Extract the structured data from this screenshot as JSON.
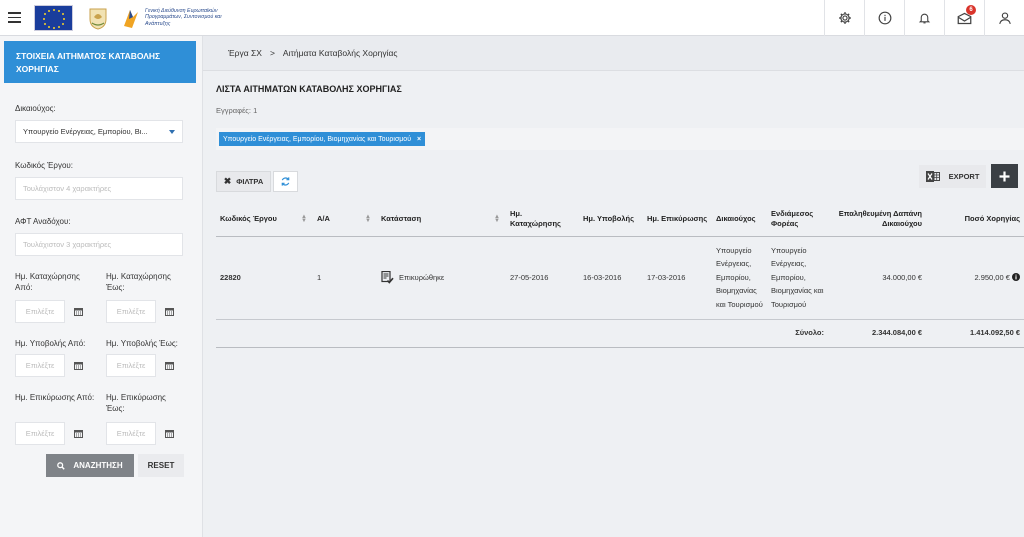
{
  "header": {
    "org_logo_text": "Γενική Διεύθυνση Ευρωπαϊκών Προγραμμάτων, Συντονισμού και Ανάπτυξης",
    "notifications_count": "6",
    "colors": {
      "accent": "#2f8fd7",
      "badge": "#d9342b",
      "eu_blue": "#1a3d9c"
    }
  },
  "sidebar": {
    "title": "ΣΤΟΙΧΕΙΑ ΑΙΤΗΜΑΤΟΣ ΚΑΤΑΒΟΛΗΣ ΧΟΡΗΓΙΑΣ",
    "beneficiary_label": "Δικαιούχος:",
    "beneficiary_value": "Υπουργείο Ενέργειας, Εμπορίου, Βι...",
    "project_code_label": "Κωδικός Έργου:",
    "project_code_placeholder": "Τουλάχιστον 4 χαρακτήρες",
    "afm_label": "ΑΦΤ Αναδόχου:",
    "afm_placeholder": "Τουλάχιστον 3 χαρακτήρες",
    "reg_from_label": "Ημ. Καταχώρησης Από:",
    "reg_to_label": "Ημ. Καταχώρησης Έως:",
    "sub_from_label": "Ημ. Υποβολής Από:",
    "sub_to_label": "Ημ. Υποβολής Έως:",
    "ver_from_label": "Ημ. Επικύρωσης Από:",
    "ver_to_label": "Ημ. Επικύρωσης Έως:",
    "date_placeholder": "Επιλέξτε",
    "search_label": "ΑΝΑΖΗΤΗΣΗ",
    "reset_label": "RESET"
  },
  "breadcrumb": [
    "Έργα ΣΧ",
    "Αιτήματα Καταβολής Χορηγίας"
  ],
  "main": {
    "title": "ΛΙΣΤΑ ΑΙΤΗΜΑΤΩΝ ΚΑΤΑΒΟΛΗΣ ΧΟΡΗΓΙΑΣ",
    "records": "Εγγραφές: 1",
    "filter_chip": "Υπουργείο Ενέργειας, Εμπορίου, Βιομηχανίας και Τουρισμού",
    "filters_label": "ΦΙΛΤΡΑ",
    "export_label": "EXPORT"
  },
  "table": {
    "columns": [
      "Κωδικός Έργου",
      "Α/Α",
      "Κατάσταση",
      "Ημ. Καταχώρησης",
      "Ημ. Υποβολής",
      "Ημ. Επικύρωσης",
      "Δικαιούχος",
      "Ενδιάμεσος Φορέας",
      "Επαληθευμένη Δαπάνη Δικαιούχου",
      "Ποσό Χορηγίας"
    ],
    "rows": [
      {
        "code": "22820",
        "aa": "1",
        "status": "Επικυρώθηκε",
        "reg_date": "27-05-2016",
        "sub_date": "16-03-2016",
        "ver_date": "17-03-2016",
        "beneficiary": "Υπουργείο Ενέργειας, Εμπορίου, Βιομηχανίας και Τουρισμού",
        "intermediate": "Υπουργείο Ενέργειας, Εμπορίου, Βιομηχανίας και Τουρισμού",
        "verified_expense": "34.000,00 €",
        "grant_amount": "2.950,00 €"
      }
    ],
    "total_label": "Σύνολο:",
    "total_expense": "2.344.084,00 €",
    "total_grant": "1.414.092,50 €"
  }
}
